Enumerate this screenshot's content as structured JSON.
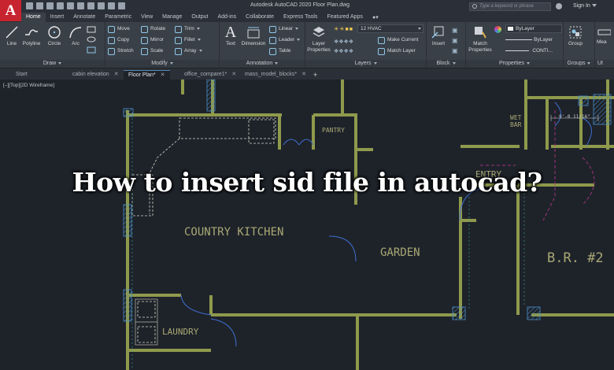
{
  "app": {
    "logo_letter": "A",
    "title": "Autodesk AutoCAD 2020    Floor Plan.dwg",
    "search_placeholder": "Type a keyword or phrase",
    "signin_label": "Sign In"
  },
  "ribbon_tabs": [
    {
      "label": "Home"
    },
    {
      "label": "Insert"
    },
    {
      "label": "Annotate"
    },
    {
      "label": "Parametric"
    },
    {
      "label": "View"
    },
    {
      "label": "Manage"
    },
    {
      "label": "Output"
    },
    {
      "label": "Add-ins"
    },
    {
      "label": "Collaborate"
    },
    {
      "label": "Express Tools"
    },
    {
      "label": "Featured Apps"
    }
  ],
  "draw_panel": {
    "title": "Draw",
    "buttons": [
      {
        "label": "Line"
      },
      {
        "label": "Polyline"
      },
      {
        "label": "Circle"
      },
      {
        "label": "Arc"
      }
    ]
  },
  "modify_panel": {
    "title": "Modify",
    "rows": [
      {
        "label": "Move"
      },
      {
        "label": "Rotate"
      },
      {
        "label": "Trim"
      },
      {
        "label": "Copy"
      },
      {
        "label": "Mirror"
      },
      {
        "label": "Fillet"
      },
      {
        "label": "Stretch"
      },
      {
        "label": "Scale"
      },
      {
        "label": "Array"
      }
    ]
  },
  "annotation_panel": {
    "title": "Annotation",
    "text_label": "Text",
    "dimension_label": "Dimension",
    "linear_label": "Linear",
    "leader_label": "Leader",
    "table_label": "Table"
  },
  "layers_panel": {
    "title": "Layers",
    "properties_label": "Layer Properties",
    "current_layer": "12 HVAC",
    "make_current_label": "Make Current",
    "match_layer_label": "Match Layer"
  },
  "block_panel": {
    "title": "Block",
    "insert_label": "Insert"
  },
  "properties_panel": {
    "title": "Properties",
    "match_label": "Match Properties",
    "color_value": "ByLayer",
    "lineweight_value": "ByLayer",
    "linetype_value": "CONTI..."
  },
  "groups_panel": {
    "title": "Groups",
    "group_label": "Group"
  },
  "utilities_panel": {
    "title": "Ut",
    "measure_label": "Mea"
  },
  "file_tabs": [
    {
      "label": "Start"
    },
    {
      "label": "cabin elevation"
    },
    {
      "label": "Floor Plan*"
    },
    {
      "label": "office_compare1*"
    },
    {
      "label": "mass_model_blocks*"
    }
  ],
  "viewport_label": "[–][Top][2D Wireframe]",
  "rooms": {
    "pantry": "PANTRY",
    "wet_bar": "WET\nBAR",
    "dimension": "9'-0 11/16\"",
    "entry": "ENTRY",
    "country_kitchen": "COUNTRY KITCHEN",
    "garden": "GARDEN",
    "bedroom": "B.R. #2",
    "laundry": "LAUNDRY"
  },
  "headline": "How to insert sid file in autocad?",
  "colors": {
    "wall": "#8f9a4c",
    "wall_hatch": "#4a90c8",
    "door": "#3f6fd0",
    "label": "#a9a874",
    "accent_logo": "#c8242f"
  }
}
